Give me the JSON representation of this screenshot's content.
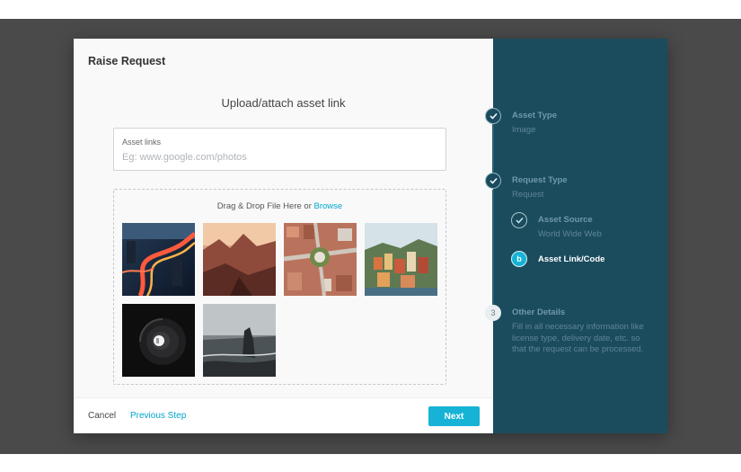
{
  "modal": {
    "title": "Raise Request",
    "section_heading": "Upload/attach asset link",
    "asset_links": {
      "label": "Asset links",
      "placeholder": "Eg: www.google.com/photos",
      "value": ""
    },
    "dropzone": {
      "text": "Drag & Drop File Here or",
      "browse_label": "Browse",
      "thumbnails": [
        "city-night-traffic-photo",
        "canyon-sunset-photo",
        "aerial-city-roundabout-photo",
        "coastal-village-photo",
        "spiral-lamp-photo",
        "sea-stack-coast-photo"
      ]
    },
    "footer": {
      "cancel_label": "Cancel",
      "previous_label": "Previous Step",
      "next_label": "Next"
    }
  },
  "stepper": {
    "steps": [
      {
        "title": "Asset Type",
        "subtitle": "Image",
        "status": "done",
        "icon": "check-icon"
      },
      {
        "title": "Request Type",
        "subtitle": "Request",
        "status": "done",
        "icon": "check-icon",
        "substeps": [
          {
            "title": "Asset Source",
            "subtitle": "World Wide Web",
            "status": "done",
            "icon": "check-icon"
          },
          {
            "title": "Asset Link/Code",
            "marker": "b",
            "status": "active"
          }
        ]
      },
      {
        "title": "Other Details",
        "marker": "3",
        "status": "pending",
        "subtitle": "Fill in all necessary information like license type, delivery date, etc. so that the request can be processed."
      }
    ]
  },
  "colors": {
    "accent": "#16b3d6",
    "link": "#00a6c9",
    "sidebar_bg": "#1b4c5e",
    "backdrop": "#4a4a4a"
  }
}
